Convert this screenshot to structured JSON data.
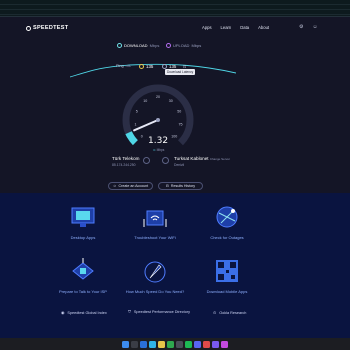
{
  "header": {
    "logo_text": "SPEEDTEST",
    "nav": [
      "Apps",
      "Learn",
      "Data",
      "About"
    ]
  },
  "modes": {
    "download_label": "DOWNLOAD",
    "download_unit": "Mbps",
    "upload_label": "UPLOAD",
    "upload_unit": "Mbps"
  },
  "stats": {
    "ping_label": "Ping",
    "ping_unit": "ms",
    "download_latency": "135",
    "upload_latency": "135",
    "tooltip": "Download Latency"
  },
  "gauge": {
    "ticks": [
      "0",
      "1",
      "5",
      "10",
      "20",
      "30",
      "50",
      "75",
      "100"
    ],
    "speed": "1.32",
    "unit": "Mbps",
    "progress_fraction": 0.08
  },
  "isp": {
    "provider": "Türk Telekom",
    "ip": "85.174.244.250",
    "server_name": "Turksat Kablonet",
    "server_tag": "Change Server",
    "server_location": "Denizli"
  },
  "buttons": {
    "create_account": "Create an Account",
    "results_history": "Results History"
  },
  "cards": [
    {
      "label": "Desktop Apps"
    },
    {
      "label": "Troubleshoot Your WiFi"
    },
    {
      "label": "Check for Outages"
    },
    {
      "label": "Prepare to Talk to Your ISP"
    },
    {
      "label": "How Much Speed Do You Need?"
    },
    {
      "label": "Download Mobile Apps"
    }
  ],
  "footer": {
    "links": [
      "Speedtest Global Index",
      "Speedtest Performance Directory",
      "Ookla Research"
    ]
  },
  "colors": {
    "accent_cyan": "#4fd6e6",
    "accent_purple": "#b46ff0",
    "background": "#141526",
    "lower_bg": "#0a1440"
  }
}
